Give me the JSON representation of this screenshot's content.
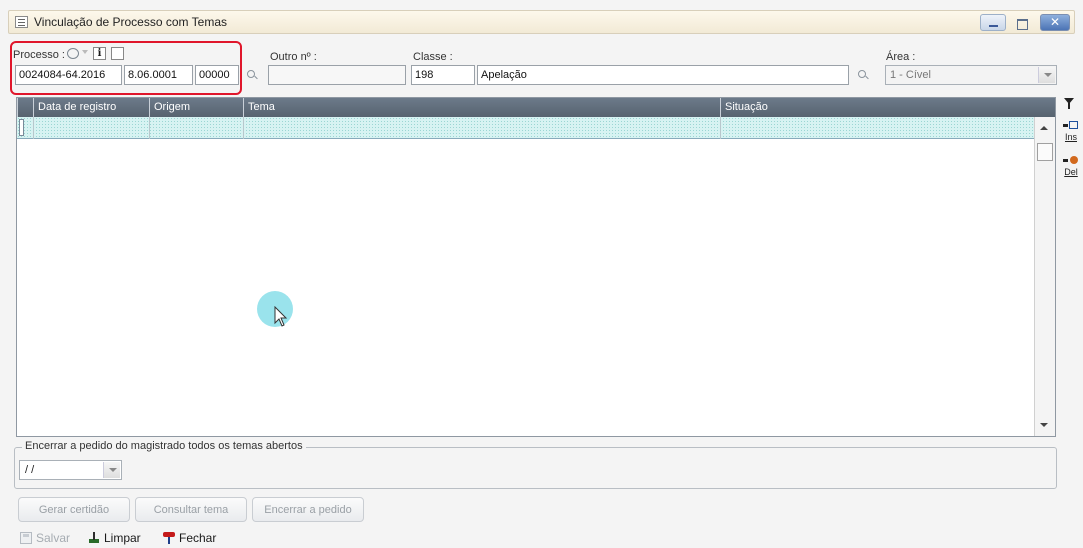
{
  "window": {
    "title": "Vinculação de Processo com Temas"
  },
  "header": {
    "processo_label": "Processo :",
    "processo_parts": [
      "0024084-64.2016",
      "8.06.0001",
      "00000"
    ],
    "outro_label": "Outro nº :",
    "outro_value": "",
    "classe_label": "Classe :",
    "classe_code": "198",
    "classe_name": "Apelação",
    "area_label": "Área :",
    "area_value": "1 - Cível"
  },
  "grid": {
    "columns": [
      "Data de registro",
      "Origem",
      "Tema",
      "Situação"
    ],
    "rows": []
  },
  "side_actions": [
    {
      "label": "Ins",
      "icon": "insert-row-icon"
    },
    {
      "label": "Del",
      "icon": "delete-row-icon"
    }
  ],
  "encerrar_group": {
    "legend": "Encerrar a pedido do magistrado todos os temas abertos",
    "date_value": "/ /"
  },
  "buttons": {
    "gerar": "Gerar certidão",
    "consultar": "Consultar tema",
    "encerrar": "Encerrar a pedido"
  },
  "toolbar": {
    "salvar": "Salvar",
    "limpar": "Limpar",
    "fechar": "Fechar"
  },
  "colors": {
    "highlight": "#e0162b",
    "grid_header": "#5f6c7a",
    "selected_row": "#d7f3f2",
    "cursor_halo": "#8fe0ea"
  }
}
